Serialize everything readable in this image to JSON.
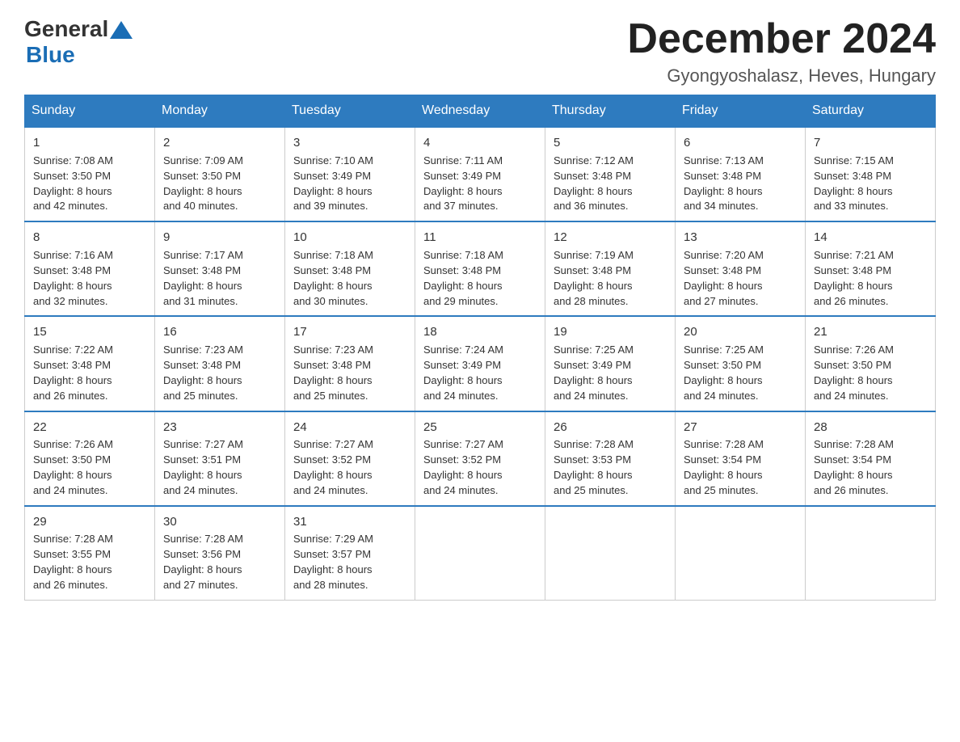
{
  "logo": {
    "general": "General",
    "blue": "Blue"
  },
  "title": "December 2024",
  "location": "Gyongyoshalasz, Heves, Hungary",
  "days_of_week": [
    "Sunday",
    "Monday",
    "Tuesday",
    "Wednesday",
    "Thursday",
    "Friday",
    "Saturday"
  ],
  "weeks": [
    [
      {
        "day": "1",
        "sunrise": "7:08 AM",
        "sunset": "3:50 PM",
        "daylight": "8 hours and 42 minutes."
      },
      {
        "day": "2",
        "sunrise": "7:09 AM",
        "sunset": "3:50 PM",
        "daylight": "8 hours and 40 minutes."
      },
      {
        "day": "3",
        "sunrise": "7:10 AM",
        "sunset": "3:49 PM",
        "daylight": "8 hours and 39 minutes."
      },
      {
        "day": "4",
        "sunrise": "7:11 AM",
        "sunset": "3:49 PM",
        "daylight": "8 hours and 37 minutes."
      },
      {
        "day": "5",
        "sunrise": "7:12 AM",
        "sunset": "3:48 PM",
        "daylight": "8 hours and 36 minutes."
      },
      {
        "day": "6",
        "sunrise": "7:13 AM",
        "sunset": "3:48 PM",
        "daylight": "8 hours and 34 minutes."
      },
      {
        "day": "7",
        "sunrise": "7:15 AM",
        "sunset": "3:48 PM",
        "daylight": "8 hours and 33 minutes."
      }
    ],
    [
      {
        "day": "8",
        "sunrise": "7:16 AM",
        "sunset": "3:48 PM",
        "daylight": "8 hours and 32 minutes."
      },
      {
        "day": "9",
        "sunrise": "7:17 AM",
        "sunset": "3:48 PM",
        "daylight": "8 hours and 31 minutes."
      },
      {
        "day": "10",
        "sunrise": "7:18 AM",
        "sunset": "3:48 PM",
        "daylight": "8 hours and 30 minutes."
      },
      {
        "day": "11",
        "sunrise": "7:18 AM",
        "sunset": "3:48 PM",
        "daylight": "8 hours and 29 minutes."
      },
      {
        "day": "12",
        "sunrise": "7:19 AM",
        "sunset": "3:48 PM",
        "daylight": "8 hours and 28 minutes."
      },
      {
        "day": "13",
        "sunrise": "7:20 AM",
        "sunset": "3:48 PM",
        "daylight": "8 hours and 27 minutes."
      },
      {
        "day": "14",
        "sunrise": "7:21 AM",
        "sunset": "3:48 PM",
        "daylight": "8 hours and 26 minutes."
      }
    ],
    [
      {
        "day": "15",
        "sunrise": "7:22 AM",
        "sunset": "3:48 PM",
        "daylight": "8 hours and 26 minutes."
      },
      {
        "day": "16",
        "sunrise": "7:23 AM",
        "sunset": "3:48 PM",
        "daylight": "8 hours and 25 minutes."
      },
      {
        "day": "17",
        "sunrise": "7:23 AM",
        "sunset": "3:48 PM",
        "daylight": "8 hours and 25 minutes."
      },
      {
        "day": "18",
        "sunrise": "7:24 AM",
        "sunset": "3:49 PM",
        "daylight": "8 hours and 24 minutes."
      },
      {
        "day": "19",
        "sunrise": "7:25 AM",
        "sunset": "3:49 PM",
        "daylight": "8 hours and 24 minutes."
      },
      {
        "day": "20",
        "sunrise": "7:25 AM",
        "sunset": "3:50 PM",
        "daylight": "8 hours and 24 minutes."
      },
      {
        "day": "21",
        "sunrise": "7:26 AM",
        "sunset": "3:50 PM",
        "daylight": "8 hours and 24 minutes."
      }
    ],
    [
      {
        "day": "22",
        "sunrise": "7:26 AM",
        "sunset": "3:50 PM",
        "daylight": "8 hours and 24 minutes."
      },
      {
        "day": "23",
        "sunrise": "7:27 AM",
        "sunset": "3:51 PM",
        "daylight": "8 hours and 24 minutes."
      },
      {
        "day": "24",
        "sunrise": "7:27 AM",
        "sunset": "3:52 PM",
        "daylight": "8 hours and 24 minutes."
      },
      {
        "day": "25",
        "sunrise": "7:27 AM",
        "sunset": "3:52 PM",
        "daylight": "8 hours and 24 minutes."
      },
      {
        "day": "26",
        "sunrise": "7:28 AM",
        "sunset": "3:53 PM",
        "daylight": "8 hours and 25 minutes."
      },
      {
        "day": "27",
        "sunrise": "7:28 AM",
        "sunset": "3:54 PM",
        "daylight": "8 hours and 25 minutes."
      },
      {
        "day": "28",
        "sunrise": "7:28 AM",
        "sunset": "3:54 PM",
        "daylight": "8 hours and 26 minutes."
      }
    ],
    [
      {
        "day": "29",
        "sunrise": "7:28 AM",
        "sunset": "3:55 PM",
        "daylight": "8 hours and 26 minutes."
      },
      {
        "day": "30",
        "sunrise": "7:28 AM",
        "sunset": "3:56 PM",
        "daylight": "8 hours and 27 minutes."
      },
      {
        "day": "31",
        "sunrise": "7:29 AM",
        "sunset": "3:57 PM",
        "daylight": "8 hours and 28 minutes."
      },
      null,
      null,
      null,
      null
    ]
  ],
  "labels": {
    "sunrise_prefix": "Sunrise: ",
    "sunset_prefix": "Sunset: ",
    "daylight_prefix": "Daylight: "
  }
}
